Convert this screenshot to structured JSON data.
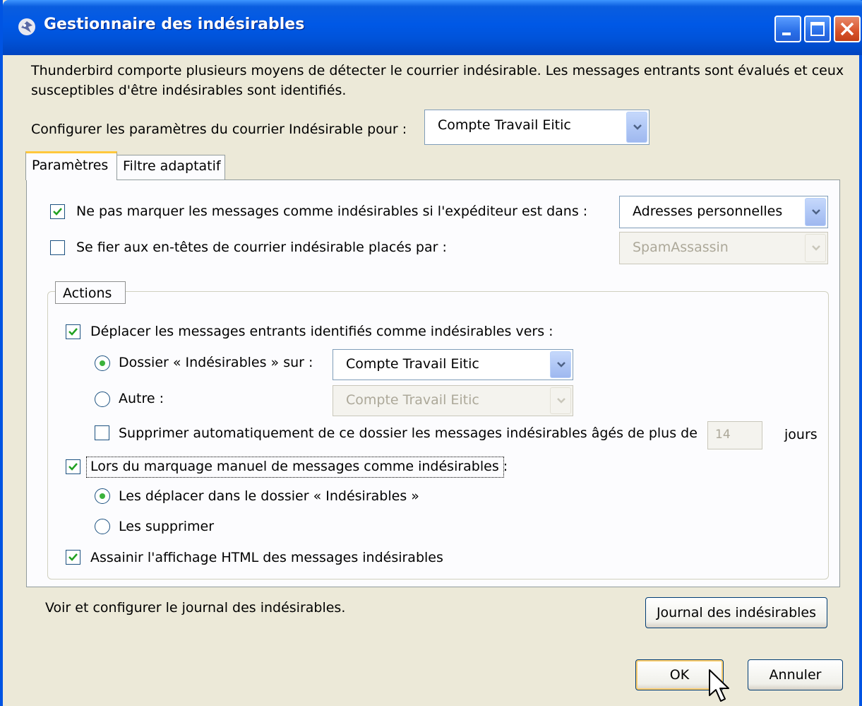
{
  "window": {
    "title": "Gestionnaire des indésirables",
    "buttons": [
      "minimize",
      "maximize",
      "close"
    ]
  },
  "intro_text": "Thunderbird comporte plusieurs moyens de détecter le courrier indésirable. Les messages entrants sont évalués et ceux susceptibles d'être indésirables sont identifiés.",
  "account_selector": {
    "label": "Configurer les paramètres du courrier Indésirable pour :",
    "value": "Compte Travail Eitic"
  },
  "tabs": [
    {
      "label": "Paramètres",
      "active": true
    },
    {
      "label": "Filtre adaptatif",
      "active": false
    }
  ],
  "settings": {
    "whitelist": {
      "checked": true,
      "label": "Ne pas marquer les messages comme indésirables si l'expéditeur est dans :",
      "value": "Adresses personnelles"
    },
    "trust_headers": {
      "checked": false,
      "label": "Se fier aux en-têtes de courrier indésirable placés par :",
      "value": "SpamAssassin"
    }
  },
  "actions": {
    "legend": "Actions",
    "move_incoming": {
      "checked": true,
      "label": "Déplacer les messages entrants identifiés comme indésirables vers :"
    },
    "junk_folder_option": {
      "selected": true,
      "label": "Dossier « Indésirables » sur :",
      "value": "Compte Travail Eitic"
    },
    "other_option": {
      "selected": false,
      "label": "Autre :",
      "value": "Compte Travail Eitic"
    },
    "auto_delete": {
      "checked": false,
      "label": "Supprimer automatiquement de ce dossier les messages indésirables âgés de plus de",
      "days": "14",
      "unit": "jours"
    },
    "manual_mark": {
      "checked": true,
      "label": "Lors du marquage manuel de messages comme indésirables :"
    },
    "manual_move": {
      "selected": true,
      "label": "Les déplacer dans le dossier « Indésirables »"
    },
    "manual_delete": {
      "selected": false,
      "label": "Les supprimer"
    },
    "sanitize_html": {
      "checked": true,
      "label": "Assainir l'affichage HTML des messages indésirables"
    }
  },
  "log": {
    "text": "Voir et configurer le journal des indésirables.",
    "button": "Journal des indésirables"
  },
  "footer": {
    "ok": "OK",
    "cancel": "Annuler"
  }
}
